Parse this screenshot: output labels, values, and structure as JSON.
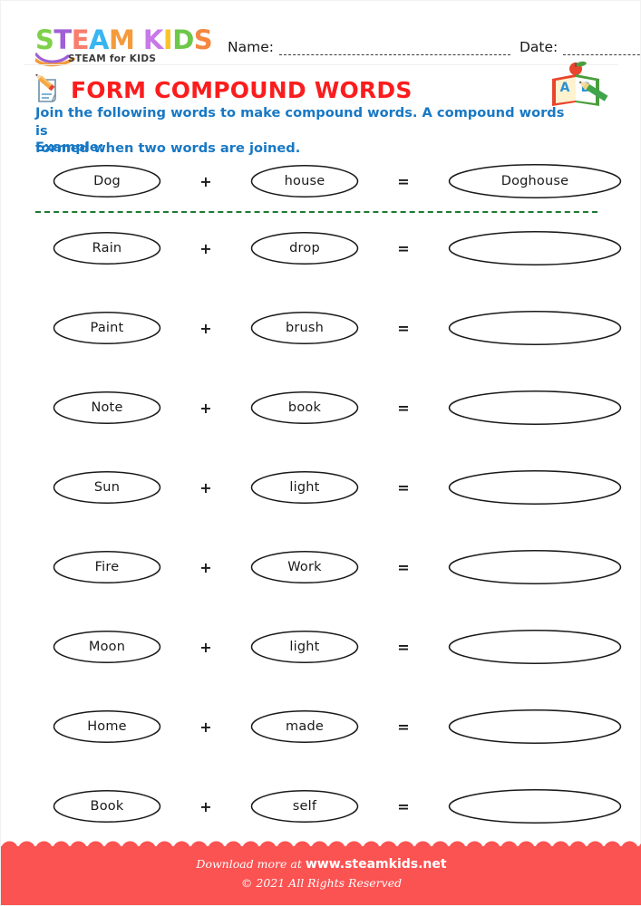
{
  "page": {
    "background": "#ffffff"
  },
  "header": {
    "logo": {
      "name": "STEAM KIDS",
      "letters": [
        {
          "char": "S",
          "color": "#7ed04b"
        },
        {
          "char": "T",
          "color": "#a05fd6"
        },
        {
          "char": "E",
          "color": "#f97d6d"
        },
        {
          "char": "A",
          "color": "#38b6f0"
        },
        {
          "char": "M",
          "color": "#f59b3c"
        },
        {
          "char": " ",
          "color": "#ffffff"
        },
        {
          "char": "K",
          "color": "#c878e8"
        },
        {
          "char": "I",
          "color": "#f7c52b"
        },
        {
          "char": "D",
          "color": "#6dc84a"
        },
        {
          "char": "S",
          "color": "#f5873f"
        }
      ],
      "tagline": "STEAM for KIDS"
    },
    "name_label": "Name:",
    "date_label": "Date:"
  },
  "title": {
    "text": "FORM COMPOUND WORDS",
    "color": "#fb1d1d",
    "icon": "notepad-pencil-icon"
  },
  "decor": {
    "book_icon": "abc-book-icon",
    "book_letters": "AB"
  },
  "instructions": {
    "line1": "Join the following words to make compound words. A compound words is",
    "line2": "formed when two words are joined.",
    "example_label": "Example:",
    "color": "#1878c4"
  },
  "operators": {
    "plus": "+",
    "equals": "="
  },
  "example_row": {
    "first": "Dog",
    "second": "house",
    "answer": "Doghouse"
  },
  "divider": {
    "color": "#1c7a33",
    "style": "dashed"
  },
  "rows": [
    {
      "first": "Rain",
      "second": "drop",
      "answer": ""
    },
    {
      "first": "Paint",
      "second": "brush",
      "answer": ""
    },
    {
      "first": "Note",
      "second": "book",
      "answer": ""
    },
    {
      "first": "Sun",
      "second": "light",
      "answer": ""
    },
    {
      "first": "Fire",
      "second": "Work",
      "answer": ""
    },
    {
      "first": "Moon",
      "second": "light",
      "answer": ""
    },
    {
      "first": "Home",
      "second": "made",
      "answer": ""
    },
    {
      "first": "Book",
      "second": "self",
      "answer": ""
    }
  ],
  "footer": {
    "download_prefix": "Download more at ",
    "site": "www.steamkids.net",
    "copyright": "© 2021 All Rights Reserved",
    "background": "#fb5252"
  }
}
